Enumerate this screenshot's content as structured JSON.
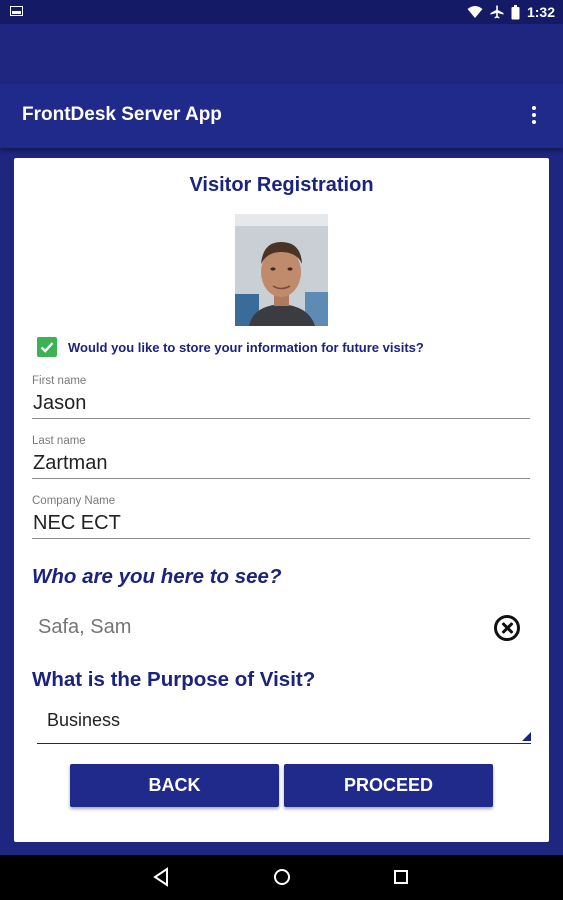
{
  "status_bar": {
    "time": "1:32",
    "icons": [
      "notification-icon",
      "wifi-icon",
      "airplane-icon",
      "battery-icon"
    ]
  },
  "toolbar": {
    "title": "FrontDesk Server App",
    "menu_icon": "overflow-menu-icon"
  },
  "form": {
    "title": "Visitor Registration",
    "consent": {
      "label": "Would you like to store your information for future visits?",
      "checked": true
    },
    "fields": {
      "first_name": {
        "label": "First name",
        "value": "Jason"
      },
      "last_name": {
        "label": "Last name",
        "value": "Zartman"
      },
      "company": {
        "label": "Company Name",
        "value": "NEC ECT"
      }
    },
    "host": {
      "question": "Who are you here to see?",
      "value": "Safa, Sam"
    },
    "purpose": {
      "question": "What is the Purpose of Visit?",
      "selected": "Business"
    },
    "buttons": {
      "back": "BACK",
      "proceed": "PROCEED"
    }
  },
  "nav_bar": {
    "icons": [
      "back-icon",
      "home-icon",
      "recents-icon"
    ]
  },
  "colors": {
    "primary": "#1f2680",
    "toolbar": "#202a8a",
    "accent_text": "#1a237e",
    "check": "#3db255"
  }
}
